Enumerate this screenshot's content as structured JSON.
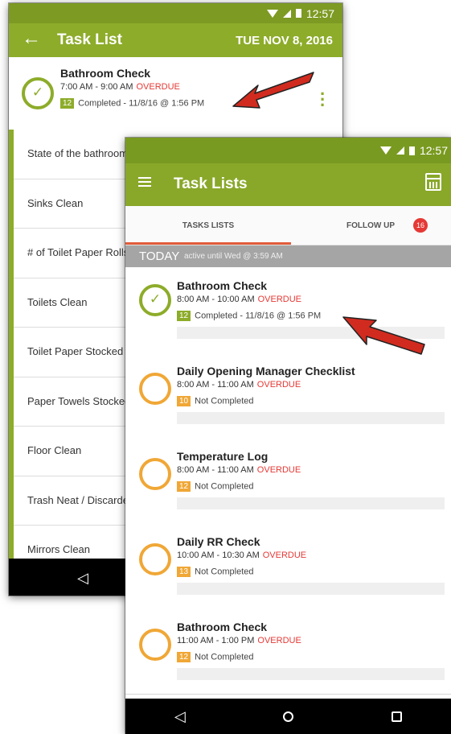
{
  "colors": {
    "brand_green": "#8dac2a",
    "status_green": "#7d9a23",
    "overdue_red": "#e53935",
    "pending_orange": "#f0a736",
    "tab_indicator": "#e25c3b",
    "arrow_red": "#d12b1f"
  },
  "back_screen": {
    "status_bar": {
      "time": "12:57"
    },
    "app_bar": {
      "back_icon": "arrow-left-icon",
      "title": "Task List",
      "date": "TUE NOV 8, 2016"
    },
    "task": {
      "title": "Bathroom Check",
      "time": "7:00 AM - 9:00 AM",
      "overdue": "OVERDUE",
      "count": "12",
      "status": "Completed - 11/8/16 @ 1:56 PM",
      "menu_icon": "more-vert-icon"
    },
    "questions": [
      "State of the bathroom",
      "Sinks Clean",
      "# of Toilet Paper Rolls",
      "Toilets Clean",
      "Toilet Paper Stocked",
      "Paper Towels Stocked",
      "Floor Clean",
      "Trash Neat / Discarded",
      "Mirrors Clean"
    ],
    "nav": {
      "back": "◁"
    }
  },
  "front_screen": {
    "status_bar": {
      "time": "12:57"
    },
    "app_bar": {
      "title": "Task Lists",
      "menu_icon": "menu-icon",
      "calendar_icon": "calendar-icon"
    },
    "tabs": [
      {
        "label": "TASKS LISTS",
        "active": true
      },
      {
        "label": "FOLLOW UP",
        "badge": "16"
      }
    ],
    "section": {
      "label": "TODAY",
      "sublabel": "active until Wed @ 3:59 AM"
    },
    "tasks": [
      {
        "title": "Bathroom Check",
        "time": "8:00 AM - 10:00 AM",
        "overdue": "OVERDUE",
        "count": "12",
        "status": "Completed - 11/8/16 @ 1:56 PM",
        "completed": true
      },
      {
        "title": "Daily Opening Manager Checklist",
        "time": "8:00 AM - 11:00 AM",
        "overdue": "OVERDUE",
        "count": "10",
        "status": "Not Completed",
        "completed": false
      },
      {
        "title": "Temperature Log",
        "time": "8:00 AM - 11:00 AM",
        "overdue": "OVERDUE",
        "count": "12",
        "status": "Not Completed",
        "completed": false
      },
      {
        "title": "Daily RR Check",
        "time": "10:00 AM - 10:30 AM",
        "overdue": "OVERDUE",
        "count": "13",
        "status": "Not Completed",
        "completed": false
      },
      {
        "title": "Bathroom Check",
        "time": "11:00 AM - 1:00 PM",
        "overdue": "OVERDUE",
        "count": "12",
        "status": "Not Completed",
        "completed": false
      }
    ],
    "nav": {
      "back": "◁"
    }
  }
}
